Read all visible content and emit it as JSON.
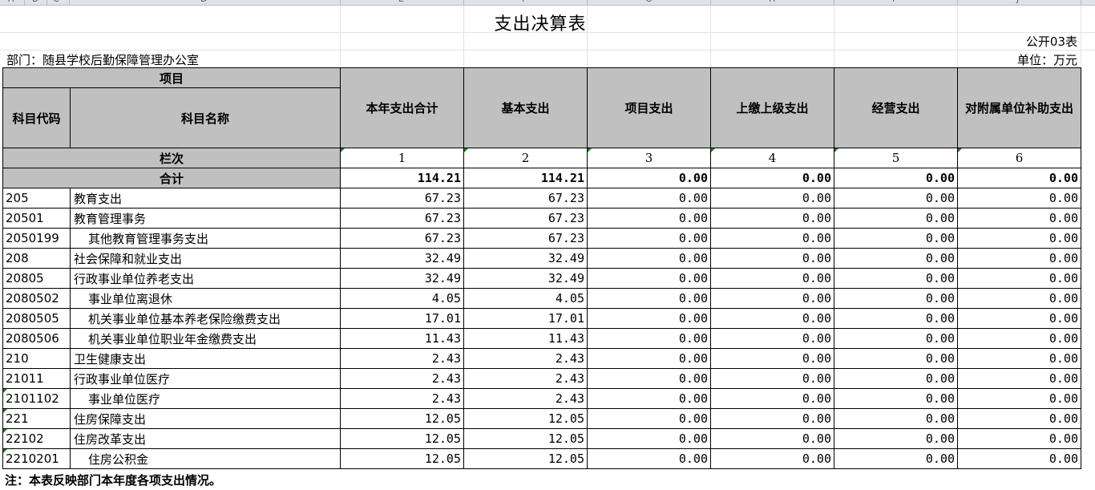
{
  "column_letters": [
    "A",
    "B",
    "C",
    "D",
    "E",
    "F",
    "G",
    "H",
    "I",
    "J"
  ],
  "title": "支出决算表",
  "form_no": "公开03表",
  "department": "部门：随县学校后勤保障管理办公室",
  "unit": "单位：万元",
  "headers": {
    "item": "项目",
    "subject_code": "科目代码",
    "subject_name": "科目名称",
    "row_index": "栏次",
    "total_label": "合计",
    "cols": [
      "本年支出合计",
      "基本支出",
      "项目支出",
      "上缴上级支出",
      "经营支出",
      "对附属单位补助支出"
    ],
    "col_numbers": [
      "1",
      "2",
      "3",
      "4",
      "5",
      "6"
    ]
  },
  "totals": [
    "114.21",
    "114.21",
    "0.00",
    "0.00",
    "0.00",
    "0.00"
  ],
  "rows": [
    {
      "code": "205",
      "name": "教育支出",
      "values": [
        "67.23",
        "67.23",
        "0.00",
        "0.00",
        "0.00",
        "0.00"
      ]
    },
    {
      "code": "20501",
      "name": "教育管理事务",
      "values": [
        "67.23",
        "67.23",
        "0.00",
        "0.00",
        "0.00",
        "0.00"
      ]
    },
    {
      "code": "2050199",
      "name": "其他教育管理事务支出",
      "values": [
        "67.23",
        "67.23",
        "0.00",
        "0.00",
        "0.00",
        "0.00"
      ]
    },
    {
      "code": "208",
      "name": "社会保障和就业支出",
      "values": [
        "32.49",
        "32.49",
        "0.00",
        "0.00",
        "0.00",
        "0.00"
      ]
    },
    {
      "code": "20805",
      "name": "行政事业单位养老支出",
      "values": [
        "32.49",
        "32.49",
        "0.00",
        "0.00",
        "0.00",
        "0.00"
      ]
    },
    {
      "code": "2080502",
      "name": "事业单位离退休",
      "values": [
        "4.05",
        "4.05",
        "0.00",
        "0.00",
        "0.00",
        "0.00"
      ]
    },
    {
      "code": "2080505",
      "name": "机关事业单位基本养老保险缴费支出",
      "values": [
        "17.01",
        "17.01",
        "0.00",
        "0.00",
        "0.00",
        "0.00"
      ]
    },
    {
      "code": "2080506",
      "name": "机关事业单位职业年金缴费支出",
      "values": [
        "11.43",
        "11.43",
        "0.00",
        "0.00",
        "0.00",
        "0.00"
      ]
    },
    {
      "code": "210",
      "name": "卫生健康支出",
      "values": [
        "2.43",
        "2.43",
        "0.00",
        "0.00",
        "0.00",
        "0.00"
      ]
    },
    {
      "code": "21011",
      "name": "行政事业单位医疗",
      "values": [
        "2.43",
        "2.43",
        "0.00",
        "0.00",
        "0.00",
        "0.00"
      ]
    },
    {
      "code": "2101102",
      "name": "事业单位医疗",
      "values": [
        "2.43",
        "2.43",
        "0.00",
        "0.00",
        "0.00",
        "0.00"
      ]
    },
    {
      "code": "221",
      "name": "住房保障支出",
      "values": [
        "12.05",
        "12.05",
        "0.00",
        "0.00",
        "0.00",
        "0.00"
      ]
    },
    {
      "code": "22102",
      "name": "住房改革支出",
      "values": [
        "12.05",
        "12.05",
        "0.00",
        "0.00",
        "0.00",
        "0.00"
      ]
    },
    {
      "code": "2210201",
      "name": "住房公积金",
      "values": [
        "12.05",
        "12.05",
        "0.00",
        "0.00",
        "0.00",
        "0.00"
      ]
    }
  ],
  "note": "注：本表反映部门本年度各项支出情况。"
}
